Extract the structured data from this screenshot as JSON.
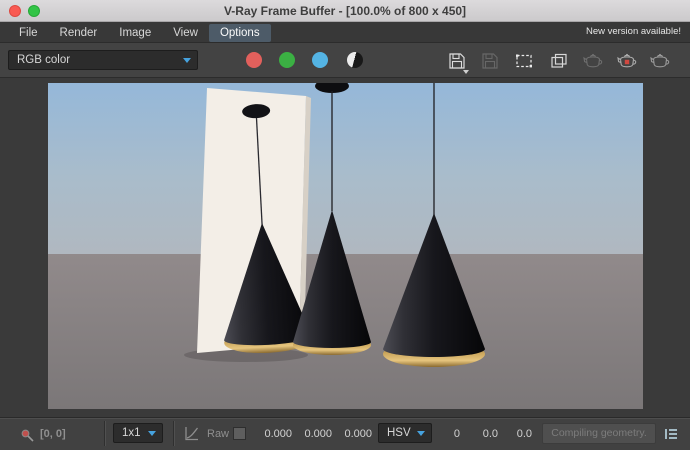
{
  "window": {
    "title": "V-Ray Frame Buffer - [100.0% of 800 x 450]"
  },
  "menubar": {
    "items": [
      {
        "label": "File"
      },
      {
        "label": "Render"
      },
      {
        "label": "Image"
      },
      {
        "label": "View"
      },
      {
        "label": "Options"
      }
    ],
    "notice": "New version available!"
  },
  "toolbar": {
    "channel_dropdown": {
      "value": "RGB color"
    },
    "channel_buttons": [
      "red-channel",
      "green-channel",
      "blue-channel",
      "mono-channel"
    ],
    "icons": [
      "save-image",
      "save-all",
      "region-render",
      "duplicate-to-host",
      "render-last",
      "stop-render",
      "render"
    ]
  },
  "statusbar": {
    "coordinates": "[0, 0]",
    "zoom_value": "1x1",
    "raw_label": "Raw",
    "raw_values": [
      "0.000",
      "0.000",
      "0.000"
    ],
    "color_space": "HSV",
    "hsv_values": [
      "0",
      "0.0",
      "0.0"
    ],
    "status_message": "Compiling geometry."
  },
  "colors": {
    "accent_blue": "#46a2de",
    "channel_red": "#e2605c",
    "channel_green": "#3bb043",
    "channel_blue": "#54b4e4",
    "menu_highlight": "#4d5b68",
    "lamp_gold": "#d3ad62",
    "sky_top": "#95b8d9",
    "ground_gray": "#7d7878"
  }
}
